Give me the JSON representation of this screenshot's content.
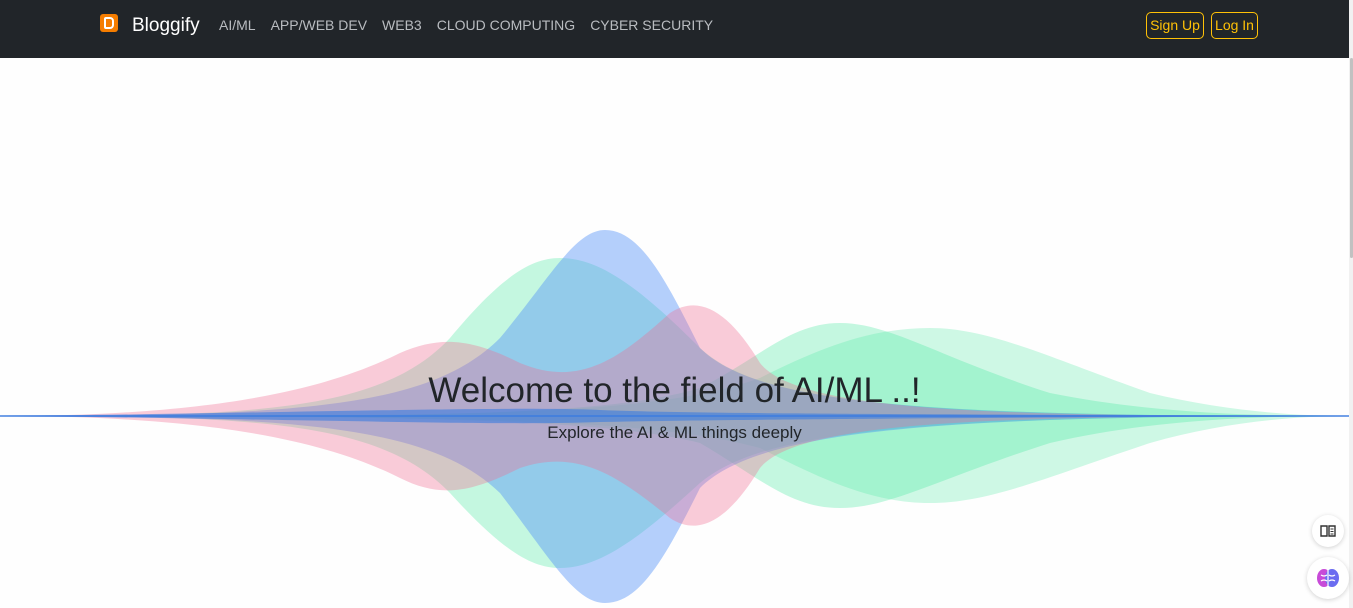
{
  "header": {
    "brand": "Bloggify",
    "nav": [
      "AI/ML",
      "APP/WEB DEV",
      "WEB3",
      "CLOUD COMPUTING",
      "CYBER SECURITY"
    ],
    "signup_label": "Sign Up",
    "login_label": "Log In",
    "accent_color": "#ffc107",
    "bg_color": "#212529"
  },
  "hero": {
    "title": "Welcome to the field of AI/ML ..!",
    "subtitle": "Explore the AI & ML things deeply",
    "wave_colors": [
      "#4f8ef7",
      "#3ee89b",
      "#f06e91"
    ]
  },
  "icons": {
    "brand": "blogger-icon",
    "reader": "reader-mode-icon",
    "assistant": "brain-icon"
  }
}
